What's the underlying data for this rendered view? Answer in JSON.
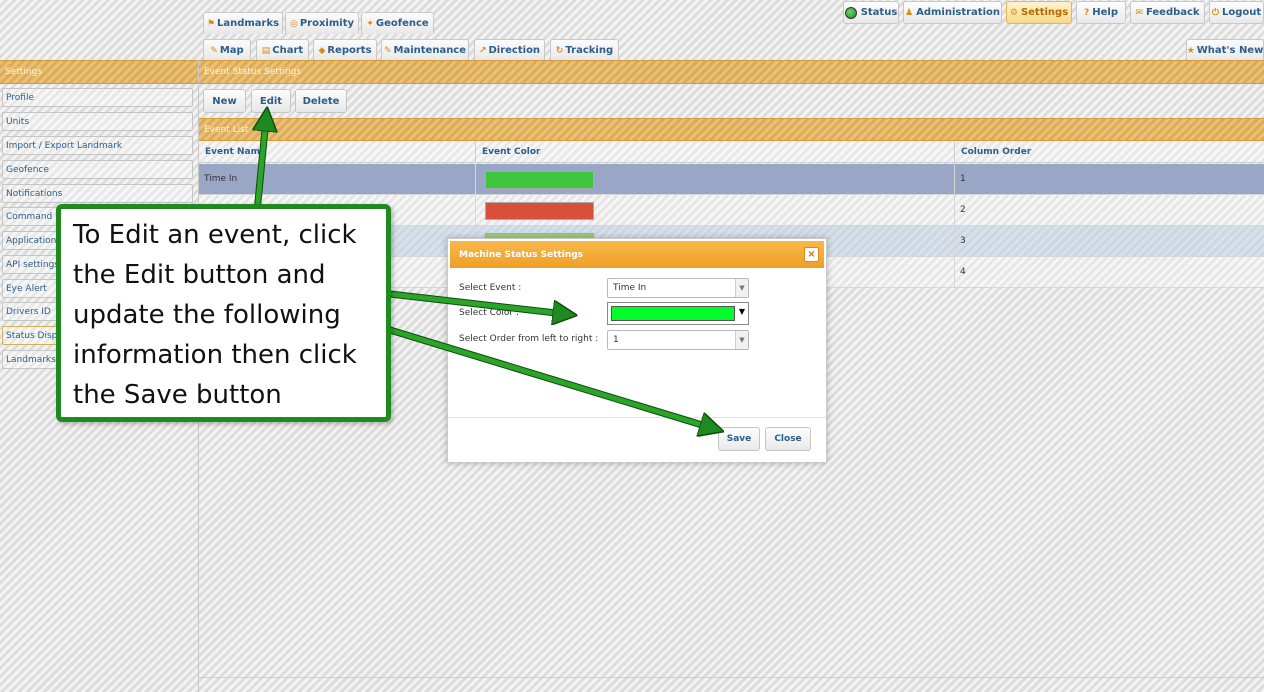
{
  "nav_row1": [
    {
      "icon": "landmark-icon",
      "label": "Landmarks"
    },
    {
      "icon": "proximity-icon",
      "label": "Proximity"
    },
    {
      "icon": "geofence-icon",
      "label": "Geofence"
    }
  ],
  "nav_row2": [
    {
      "icon": "map-icon",
      "label": "Map"
    },
    {
      "icon": "chart-icon",
      "label": "Chart"
    },
    {
      "icon": "reports-icon",
      "label": "Reports"
    },
    {
      "icon": "maintenance-icon",
      "label": "Maintenance"
    },
    {
      "icon": "direction-icon",
      "label": "Direction"
    },
    {
      "icon": "tracking-icon",
      "label": "Tracking"
    }
  ],
  "top_menu": [
    {
      "icon": "status-icon",
      "label": "Status"
    },
    {
      "icon": "administration-icon",
      "label": "Administration"
    },
    {
      "icon": "settings-icon",
      "label": "Settings",
      "active": true
    },
    {
      "icon": "help-icon",
      "label": "Help"
    },
    {
      "icon": "feedback-icon",
      "label": "Feedback"
    },
    {
      "icon": "logout-icon",
      "label": "Logout"
    }
  ],
  "whats_new": "What's New",
  "sidebar": {
    "title": "Settings",
    "items": [
      "Profile",
      "Units",
      "Import / Export Landmark",
      "Geofence",
      "Notifications",
      "Command",
      "Applications",
      "API settings",
      "Eye Alert",
      "Drivers ID",
      "Status Display",
      "Landmarks"
    ]
  },
  "main": {
    "title": "Event Status Settings",
    "actions": {
      "new": "New",
      "edit": "Edit",
      "delete": "Delete"
    },
    "list_title": "Event List",
    "columns": {
      "name": "Event Name",
      "color": "Event Color",
      "order": "Column Order"
    },
    "rows": [
      {
        "name": "Time In",
        "color": "#3fc63f",
        "order": "1"
      },
      {
        "name": "",
        "color": "#d9503a",
        "order": "2"
      },
      {
        "name": "",
        "color": "#9ccc7a",
        "order": "3"
      },
      {
        "name": "",
        "color": "",
        "order": "4"
      }
    ]
  },
  "dialog": {
    "title": "Machine Status Settings",
    "close": "×",
    "event_label": "Select Event :",
    "event_value": "Time In",
    "color_label": "Select Color :",
    "color_value": "#00ff2a",
    "order_label": "Select Order from left to right :",
    "order_value": "1",
    "save": "Save",
    "close_btn": "Close"
  },
  "callout": {
    "text": "To Edit an event, click the Edit button and update the following information then click the Save button"
  },
  "colors": {
    "accent_gold": "#e5b25a",
    "link_blue": "#2c5e8a",
    "callout_green": "#1f8a1f"
  }
}
